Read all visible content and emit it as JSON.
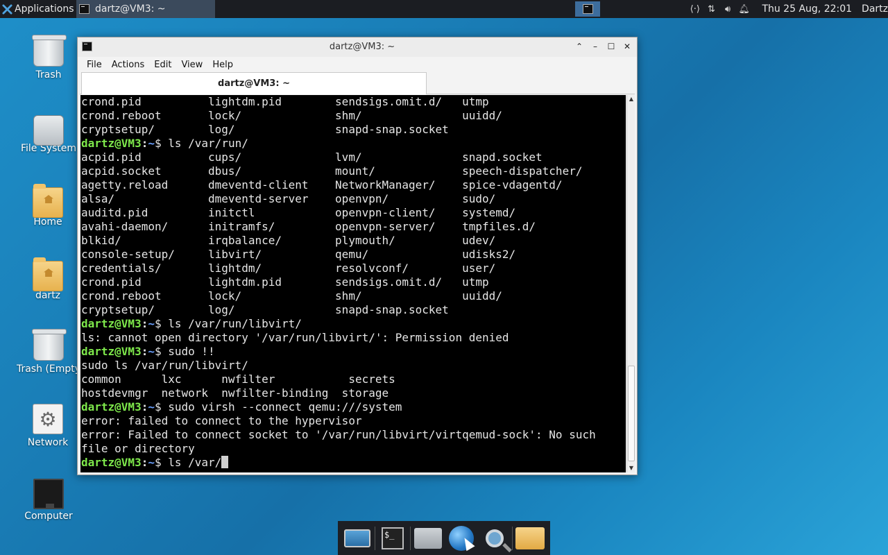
{
  "top_panel": {
    "apps_label": "Applications",
    "task_title": "dartz@VM3: ~",
    "clock": "Thu 25 Aug, 22:01",
    "user": "Dartz"
  },
  "desktop_icons": [
    {
      "label": "Trash",
      "icon": "trash-icon"
    },
    {
      "label": "File System",
      "icon": "disk-icon"
    },
    {
      "label": "Home",
      "icon": "home-folder-icon"
    },
    {
      "label": "dartz",
      "icon": "home-folder-icon"
    },
    {
      "label": "Trash (Empty",
      "icon": "trash-icon"
    },
    {
      "label": "Network",
      "icon": "gear-icon"
    },
    {
      "label": "Computer",
      "icon": "monitor-icon"
    }
  ],
  "window": {
    "title": "dartz@VM3: ~",
    "tab_title": "dartz@VM3: ~",
    "menu": [
      "File",
      "Actions",
      "Edit",
      "View",
      "Help"
    ]
  },
  "terminal": {
    "prompt_user": "dartz@VM3",
    "prompt_path": "~",
    "lines": [
      {
        "t": "out",
        "text": "crond.pid          lightdm.pid        sendsigs.omit.d/   utmp"
      },
      {
        "t": "out",
        "text": "crond.reboot       lock/              shm/               uuidd/"
      },
      {
        "t": "out",
        "text": "cryptsetup/        log/               snapd-snap.socket"
      },
      {
        "t": "cmd",
        "text": "$ ls /var/run/"
      },
      {
        "t": "out",
        "text": "acpid.pid          cups/              lvm/               snapd.socket"
      },
      {
        "t": "out",
        "text": "acpid.socket       dbus/              mount/             speech-dispatcher/"
      },
      {
        "t": "out",
        "text": "agetty.reload      dmeventd-client    NetworkManager/    spice-vdagentd/"
      },
      {
        "t": "out",
        "text": "alsa/              dmeventd-server    openvpn/           sudo/"
      },
      {
        "t": "out",
        "text": "auditd.pid         initctl            openvpn-client/    systemd/"
      },
      {
        "t": "out",
        "text": "avahi-daemon/      initramfs/         openvpn-server/    tmpfiles.d/"
      },
      {
        "t": "out",
        "text": "blkid/             irqbalance/        plymouth/          udev/"
      },
      {
        "t": "out",
        "text": "console-setup/     libvirt/           qemu/              udisks2/"
      },
      {
        "t": "out",
        "text": "credentials/       lightdm/           resolvconf/        user/"
      },
      {
        "t": "out",
        "text": "crond.pid          lightdm.pid        sendsigs.omit.d/   utmp"
      },
      {
        "t": "out",
        "text": "crond.reboot       lock/              shm/               uuidd/"
      },
      {
        "t": "out",
        "text": "cryptsetup/        log/               snapd-snap.socket"
      },
      {
        "t": "cmd",
        "text": "$ ls /var/run/libvirt/"
      },
      {
        "t": "out",
        "text": "ls: cannot open directory '/var/run/libvirt/': Permission denied"
      },
      {
        "t": "cmd",
        "text": "$ sudo !!"
      },
      {
        "t": "out",
        "text": "sudo ls /var/run/libvirt/"
      },
      {
        "t": "out",
        "text": "common      lxc      nwfilter           secrets"
      },
      {
        "t": "out",
        "text": "hostdevmgr  network  nwfilter-binding  storage"
      },
      {
        "t": "cmd",
        "text": "$ sudo virsh --connect qemu:///system"
      },
      {
        "t": "out",
        "text": "error: failed to connect to the hypervisor"
      },
      {
        "t": "out",
        "text": "error: Failed to connect socket to '/var/run/libvirt/virtqemud-sock': No such"
      },
      {
        "t": "out",
        "text": "file or directory"
      },
      {
        "t": "cmd",
        "text": "$ ls /var/",
        "cursor": true
      }
    ]
  },
  "dock": [
    "screen-icon",
    "terminal-icon",
    "file-manager-icon",
    "web-browser-icon",
    "search-icon",
    "folder-icon"
  ]
}
